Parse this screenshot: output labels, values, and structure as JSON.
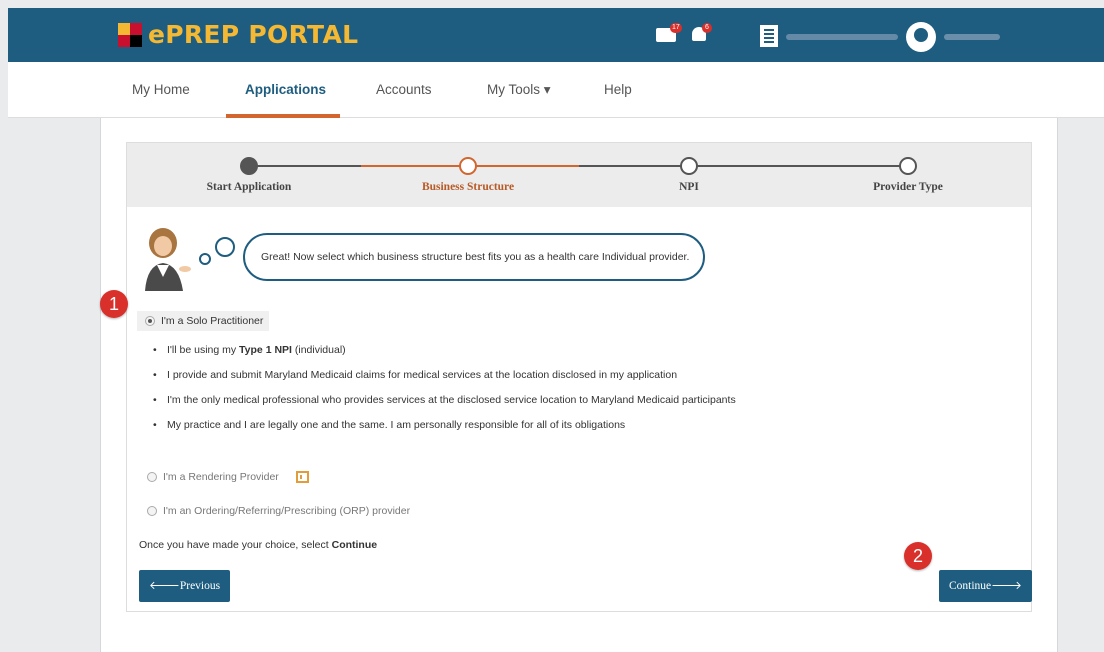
{
  "app": {
    "title": "ePREP PORTAL"
  },
  "topbar": {
    "mail_badge": "17",
    "bell_badge": "6"
  },
  "nav": {
    "items": [
      {
        "label": "My Home"
      },
      {
        "label": "Applications"
      },
      {
        "label": "Accounts"
      },
      {
        "label": "My Tools ▾"
      },
      {
        "label": "Help"
      }
    ],
    "active": "Applications"
  },
  "stepper": {
    "steps": [
      {
        "label": "Start Application",
        "state": "done"
      },
      {
        "label": "Business Structure",
        "state": "current"
      },
      {
        "label": "NPI",
        "state": "pending"
      },
      {
        "label": "Provider Type",
        "state": "pending"
      }
    ]
  },
  "assistant": {
    "message": "Great! Now select which business structure best fits you as a health care Individual provider."
  },
  "options": {
    "solo": {
      "label": "I'm a Solo Practitioner",
      "selected": true
    },
    "solo_details": {
      "line1_prefix": "I'll be using my ",
      "line1_bold": "Type 1 NPI",
      "line1_suffix": " (individual)",
      "line2": "I provide and submit Maryland Medicaid claims for medical services at the location disclosed in my application",
      "line3": "I'm the only medical professional who provides services at the disclosed service location to Maryland Medicaid participants",
      "line4": "My practice and I are legally one and the same. I am personally responsible for all of its obligations"
    },
    "rendering": {
      "label": "I'm a Rendering Provider",
      "selected": false
    },
    "orp": {
      "label": "I'm an Ordering/Referring/Prescribing (ORP) provider",
      "selected": false
    }
  },
  "instruction": {
    "prefix": "Once you have made your choice, select ",
    "bold": "Continue"
  },
  "buttons": {
    "previous": "🡐Previous",
    "continue": "Continue🡒"
  },
  "markers": {
    "one": "1",
    "two": "2"
  },
  "colors": {
    "brand": "#1f5d80",
    "accent": "#d2662e",
    "logo": "#f5b833",
    "marker": "#d9302b"
  }
}
